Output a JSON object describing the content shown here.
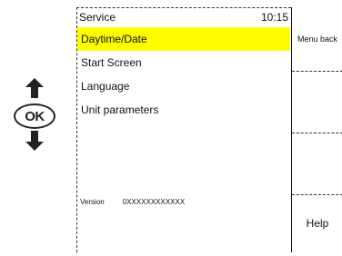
{
  "nav": {
    "ok_label": "OK"
  },
  "header": {
    "title": "Service",
    "time": "10:15"
  },
  "menu": {
    "items": [
      {
        "label": "Daytime/Date",
        "selected": true
      },
      {
        "label": "Start  Screen",
        "selected": false
      },
      {
        "label": "Language",
        "selected": false
      },
      {
        "label": "Unit  parameters",
        "selected": false
      }
    ]
  },
  "version": {
    "label": "Version",
    "value": "0XXXXXXXXXXXX"
  },
  "softkeys": {
    "menu_back": "Menu back",
    "help": "Help"
  },
  "colors": {
    "highlight": "#fffb00"
  }
}
